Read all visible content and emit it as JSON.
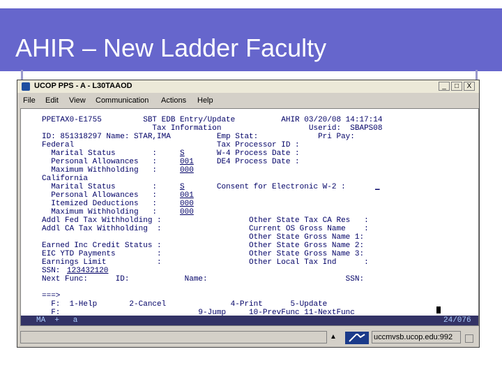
{
  "slide": {
    "title": "AHIR – New Ladder Faculty"
  },
  "window": {
    "title": "UCOP PPS - A - L30TAAOD",
    "controls": {
      "minimize": "_",
      "maximize": "□",
      "close": "X"
    },
    "menu": [
      "File",
      "Edit",
      "View",
      "Communication",
      "Actions",
      "Help"
    ]
  },
  "terminal": {
    "lines": [
      "PPETAX0-E1755         SBT EDB Entry/Update          AHIR 03/20/08 14:17:14",
      "                        Tax Information                   Userid:  SBAPS08",
      "ID: 851318297 Name: STAR,IMA          Emp Stat:             Pri Pay:",
      "Federal                               Tax Processor ID :",
      "  Marital Status        :             W-4 Process Date :",
      "  Personal Allowances   :             DE4 Process Date :",
      "  Maximum Withholding   :",
      "California",
      "  Marital Status        :             Consent for Electronic W-2 :",
      "  Personal Allowances   :",
      "  Itemized Deductions   :",
      "  Maximum Withholding   :",
      "Addl Fed Tax Withholding :                   Other State Tax CA Res   :",
      "Addl CA Tax Withholding  :                   Current OS Gross Name    :",
      "                                             Other State Gross Name 1:",
      "Earned Inc Credit Status :                   Other State Gross Name 2:",
      "EIC YTD Payments         :                   Other State Gross Name 3:",
      "Earnings Limit           :                   Other Local Tax Ind      :",
      "SSN:",
      "Next Func:      ID:            Name:                              SSN:",
      "",
      "===>",
      "  F:  1-Help       2-Cancel              4-Print      5-Update",
      "  F:                              9-Jump     10-PrevFunc 11-NextFunc"
    ],
    "fields": {
      "fed_marital": "S",
      "fed_allowances": "001",
      "fed_max_withholding": "000",
      "ca_marital": "S",
      "ca_allowances": "001",
      "ca_itemized": "000",
      "ca_max_withholding": "000",
      "ssn": "123432120",
      "consent": "_"
    },
    "oia": {
      "left": "MA  +   a",
      "right": "24/076"
    }
  },
  "statusbar": {
    "host": "uccmvsb.ucop.edu:992",
    "arrow": "▲"
  }
}
